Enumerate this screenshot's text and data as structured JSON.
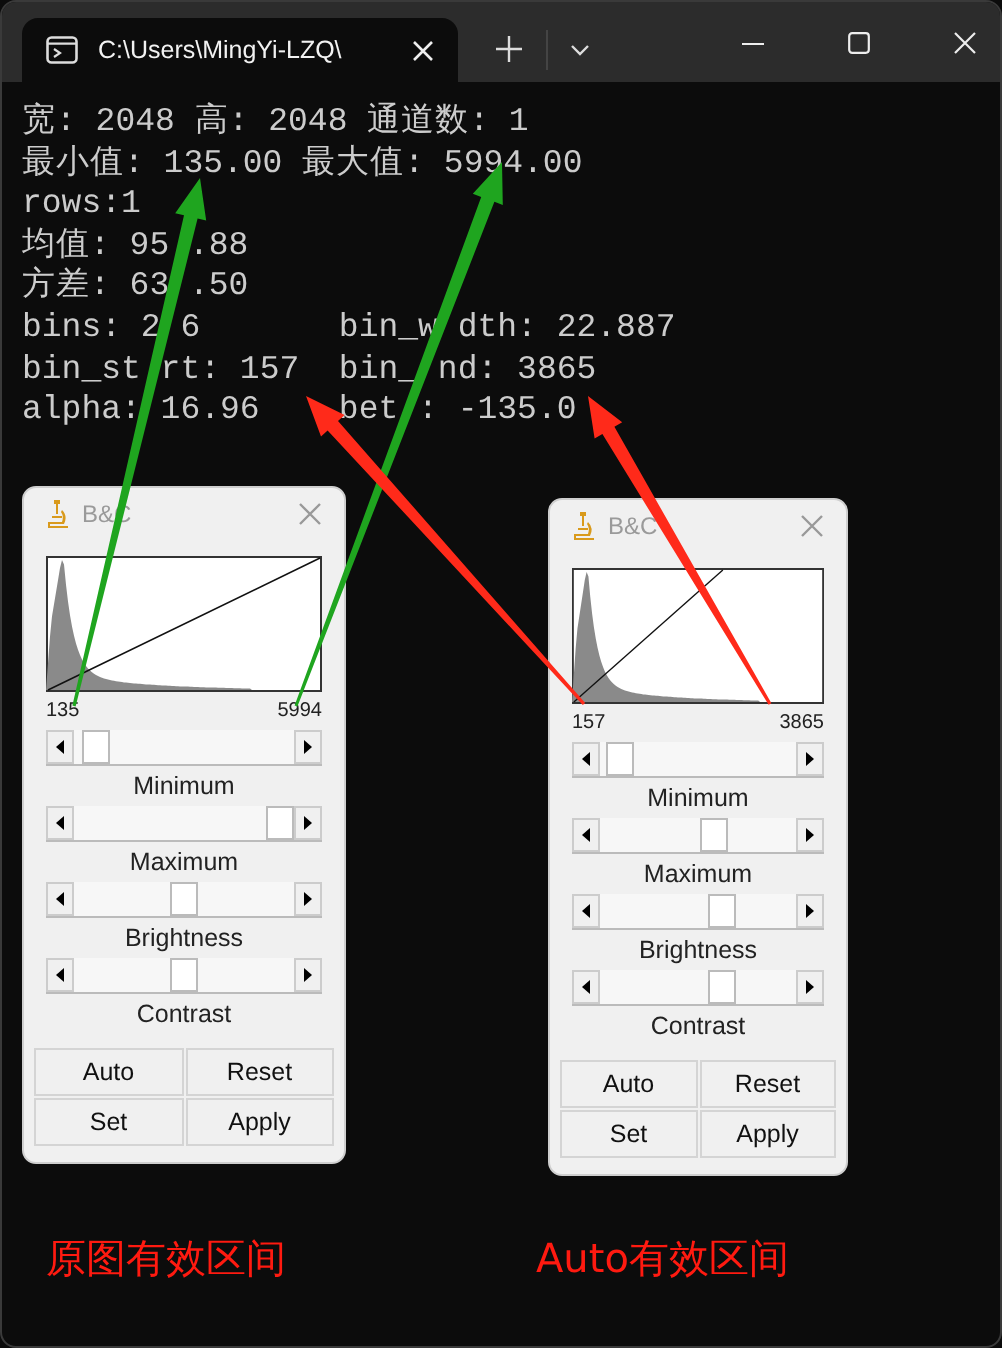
{
  "window": {
    "tab_title": "C:\\Users\\MingYi-LZQ\\"
  },
  "console_lines": [
    "宽: 2048 高: 2048 通道数: 1",
    "最小值: 135.00 最大值: 5994.00",
    "rows:1",
    "均值: 95 .88",
    "方差: 63 .50",
    "bins: 2 6       bin_w dth: 22.887",
    "bin_st rt: 157  bin_ nd: 3865",
    "alpha: 16.96    bet : -135.0"
  ],
  "bc_windows": [
    {
      "title": "B&C",
      "min_label": "135",
      "max_label": "5994",
      "sliders": [
        {
          "label": "Minimum",
          "level": 0.04
        },
        {
          "label": "Maximum",
          "level": 1.0
        },
        {
          "label": "Brightness",
          "level": 0.5
        },
        {
          "label": "Contrast",
          "level": 0.5
        }
      ],
      "buttons": [
        "Auto",
        "Reset",
        "Set",
        "Apply"
      ]
    },
    {
      "title": "B&C",
      "min_label": "157",
      "max_label": "3865",
      "sliders": [
        {
          "label": "Minimum",
          "level": 0.04
        },
        {
          "label": "Maximum",
          "level": 0.6
        },
        {
          "label": "Brightness",
          "level": 0.64
        },
        {
          "label": "Contrast",
          "level": 0.64
        }
      ],
      "buttons": [
        "Auto",
        "Reset",
        "Set",
        "Apply"
      ]
    }
  ],
  "captions": [
    "原图有效区间",
    "Auto有效区间"
  ]
}
